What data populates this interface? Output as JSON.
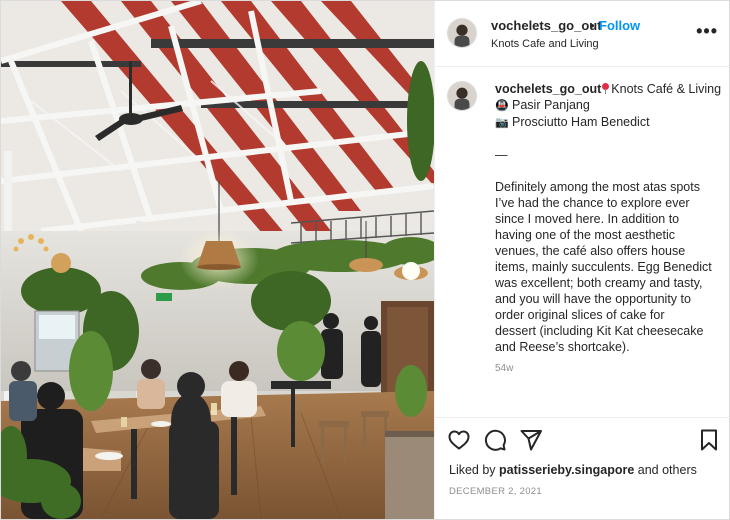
{
  "post": {
    "username": "vochelets_go_out",
    "separator": "•",
    "follow_label": "Follow",
    "location": "Knots Cafe and Living",
    "more_icon": "more-horizontal-icon",
    "more_label": "•••"
  },
  "caption": {
    "username": "vochelets_go_out",
    "title": "Knots Café & Living",
    "pin_icon": "round-pushpin-emoji",
    "place_icon": "metro-emoji",
    "place_glyph": "🚇",
    "place": "Pasir Panjang",
    "dish_icon": "camera-emoji",
    "dish_glyph": "📷",
    "dish": "Prosciutto Ham Benedict",
    "divider": "—",
    "lines": [
      "Definitely among the most atas spots",
      "I’ve had the chance to explore ever",
      "since I moved here. In addition to",
      "having one of the most aesthetic",
      "venues, the café also offers house",
      "items, mainly succulents. Egg Benedict",
      "was excellent; both creamy and tasty,",
      "and you will have the opportunity to",
      "order original slices of cake for",
      "dessert (including Kit Kat cheesecake",
      "and Reese’s shortcake)."
    ],
    "age": "54w"
  },
  "actions": {
    "like_icon": "heart-icon",
    "comment_icon": "comment-icon",
    "share_icon": "send-icon",
    "save_icon": "bookmark-icon"
  },
  "likes": {
    "prefix": "Liked by",
    "user": "patisserieby.singapore",
    "suffix": "and others"
  },
  "date": "DECEMBER 2, 2021",
  "colors": {
    "link_blue": "#0095f6",
    "text": "#262626",
    "muted": "#8e8e8e",
    "border": "#efefef"
  }
}
